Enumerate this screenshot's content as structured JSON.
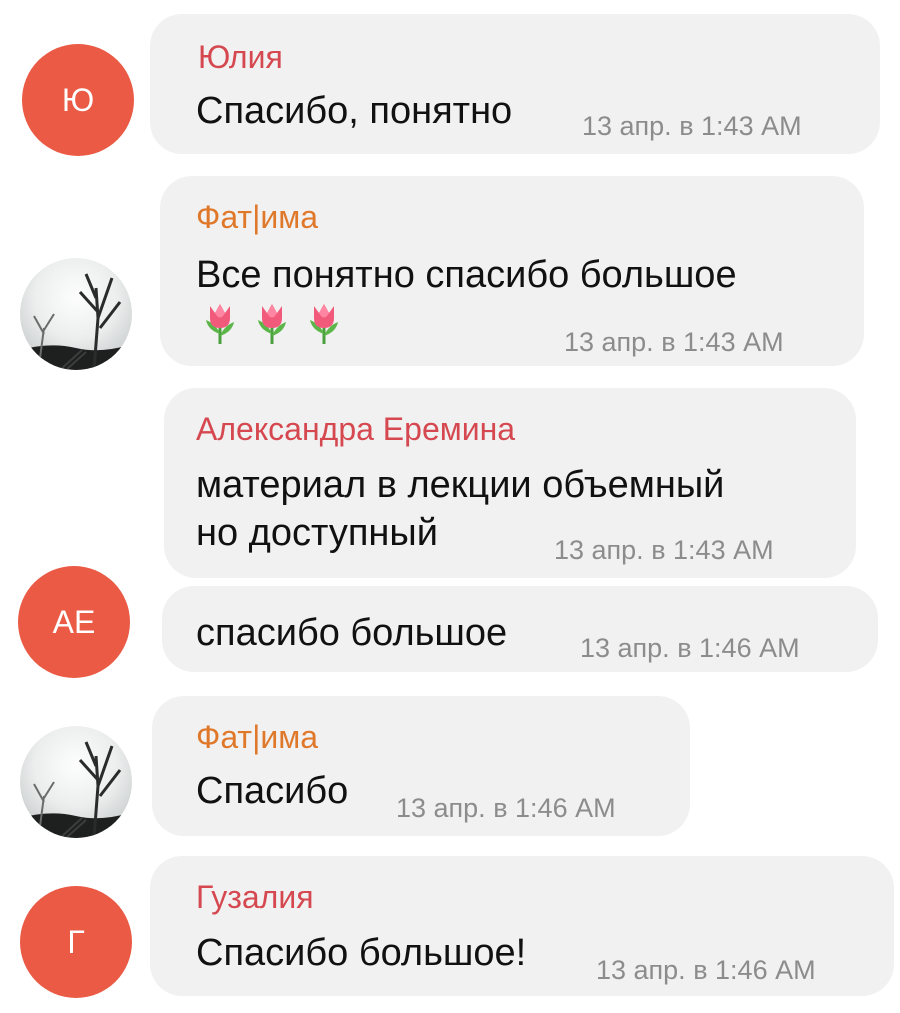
{
  "colors": {
    "avatar_bg": "#ea5a44",
    "bubble_bg": "#f1f1f2",
    "name_red": "#d6484f",
    "name_orange": "#e0782a",
    "time": "#8c8c8c"
  },
  "messages": [
    {
      "avatar": "Ю",
      "sender": "Юлия",
      "text": "Спасибо, понятно",
      "time": "13 апр. в 1:43 AM"
    },
    {
      "avatar_icon": "foggy-trees-photo",
      "sender": "Фат|има",
      "text_lines": [
        "Все понятно спасибо большое"
      ],
      "emoji": [
        "tulip",
        "tulip",
        "tulip"
      ],
      "time": "13 апр. в 1:43 AM"
    },
    {
      "sender": "Александра Еремина",
      "text_lines": [
        "материал в лекции объемный",
        "но доступный"
      ],
      "time": "13 апр. в 1:43 AM"
    },
    {
      "avatar": "АЕ",
      "text": "спасибо большое",
      "time": "13 апр. в 1:46 AM"
    },
    {
      "avatar_icon": "foggy-trees-photo",
      "sender": "Фат|има",
      "text": "Спасибо",
      "time": "13 апр. в 1:46 AM"
    },
    {
      "avatar": "Г",
      "sender": "Гузалия",
      "text": "Спасибо большое!",
      "time": "13 апр. в 1:46 AM"
    }
  ]
}
